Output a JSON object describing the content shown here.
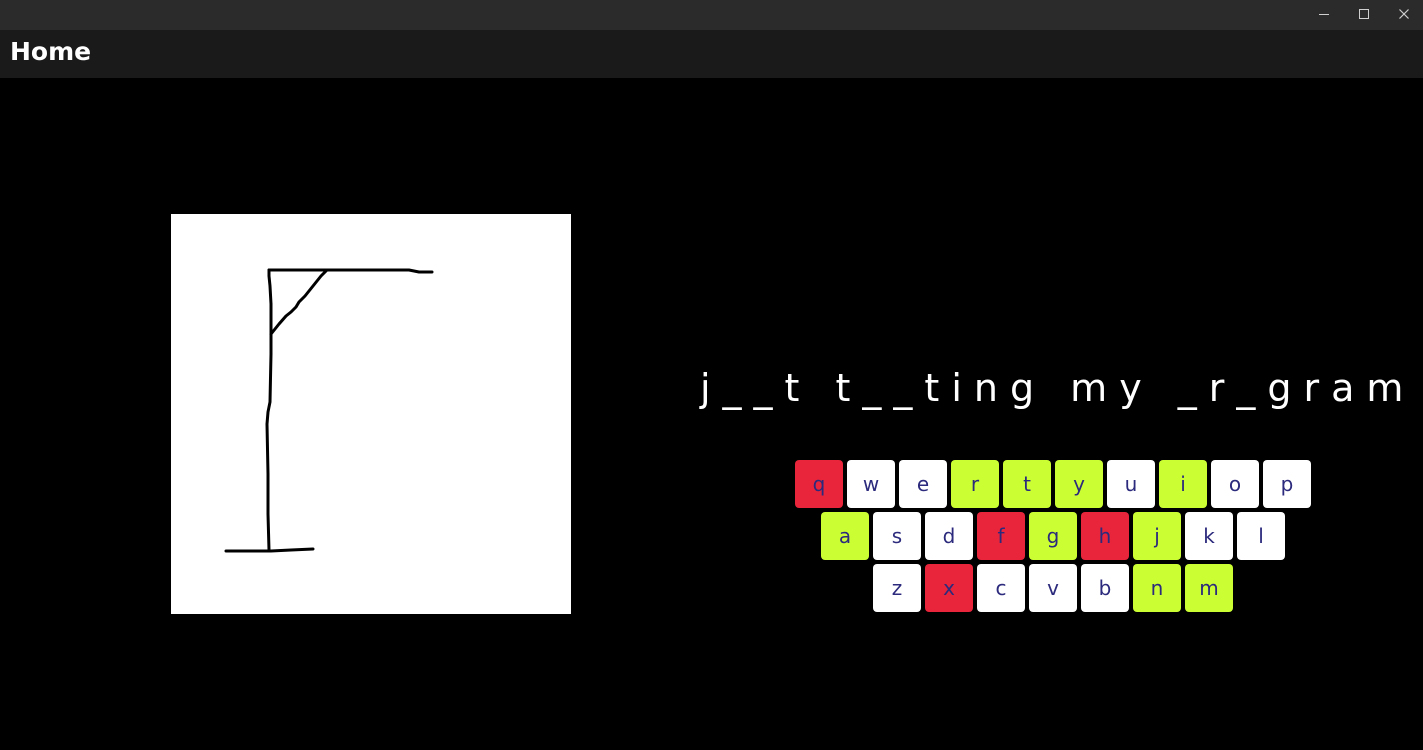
{
  "window": {
    "controls": [
      {
        "name": "minimize-button",
        "icon": "minimize-icon"
      },
      {
        "name": "maximize-button",
        "icon": "maximize-icon"
      },
      {
        "name": "close-button",
        "icon": "close-icon"
      }
    ]
  },
  "header": {
    "title": "Home"
  },
  "game": {
    "word_display": "j__t t__ting my _r_gram",
    "colors": {
      "correct": "#ccff33",
      "wrong": "#e8253b",
      "unused": "#ffffff",
      "key_text": "#2c2a7c"
    },
    "keyboard": {
      "row1": [
        {
          "letter": "q",
          "state": "wrong"
        },
        {
          "letter": "w",
          "state": "unused"
        },
        {
          "letter": "e",
          "state": "unused"
        },
        {
          "letter": "r",
          "state": "correct"
        },
        {
          "letter": "t",
          "state": "correct"
        },
        {
          "letter": "y",
          "state": "correct"
        },
        {
          "letter": "u",
          "state": "unused"
        },
        {
          "letter": "i",
          "state": "correct"
        },
        {
          "letter": "o",
          "state": "unused"
        },
        {
          "letter": "p",
          "state": "unused"
        }
      ],
      "row2": [
        {
          "letter": "a",
          "state": "correct"
        },
        {
          "letter": "s",
          "state": "unused"
        },
        {
          "letter": "d",
          "state": "unused"
        },
        {
          "letter": "f",
          "state": "wrong"
        },
        {
          "letter": "g",
          "state": "correct"
        },
        {
          "letter": "h",
          "state": "wrong"
        },
        {
          "letter": "j",
          "state": "correct"
        },
        {
          "letter": "k",
          "state": "unused"
        },
        {
          "letter": "l",
          "state": "unused"
        }
      ],
      "row3": [
        {
          "letter": "z",
          "state": "unused"
        },
        {
          "letter": "x",
          "state": "wrong"
        },
        {
          "letter": "c",
          "state": "unused"
        },
        {
          "letter": "v",
          "state": "unused"
        },
        {
          "letter": "b",
          "state": "unused"
        },
        {
          "letter": "n",
          "state": "correct"
        },
        {
          "letter": "m",
          "state": "correct"
        }
      ]
    }
  }
}
